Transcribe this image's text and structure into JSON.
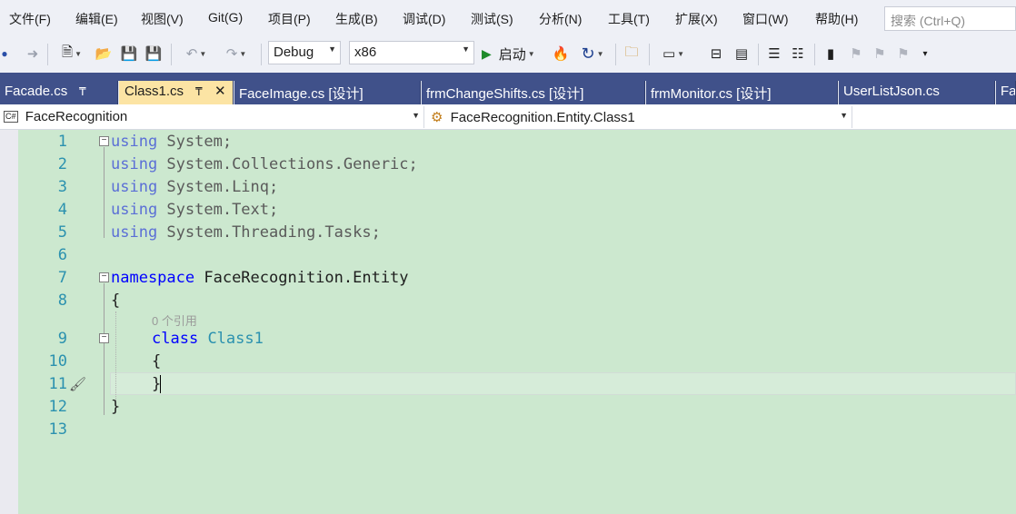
{
  "menu": {
    "items": [
      "文件(F)",
      "编辑(E)",
      "视图(V)",
      "Git(G)",
      "项目(P)",
      "生成(B)",
      "调试(D)",
      "测试(S)",
      "分析(N)",
      "工具(T)",
      "扩展(X)",
      "窗口(W)",
      "帮助(H)"
    ],
    "search_placeholder": "搜索 (Ctrl+Q)"
  },
  "toolbar": {
    "configuration": "Debug",
    "platform": "x86",
    "start_label": "启动"
  },
  "tabs": [
    {
      "label": "Facade.cs",
      "active": false,
      "pinned": true
    },
    {
      "label": "Class1.cs",
      "active": true,
      "pinned": true
    },
    {
      "label": "FaceImage.cs [设计]",
      "active": false
    },
    {
      "label": "frmChangeShifts.cs [设计]",
      "active": false
    },
    {
      "label": "frmMonitor.cs [设计]",
      "active": false
    },
    {
      "label": "UserListJson.cs",
      "active": false
    },
    {
      "label": "Fa",
      "active": false
    }
  ],
  "navbar": {
    "project": "FaceRecognition",
    "project_badge": "C#",
    "type": "FaceRecognition.Entity.Class1",
    "member": ""
  },
  "editor": {
    "line_numbers": [
      "1",
      "2",
      "3",
      "4",
      "5",
      "6",
      "7",
      "8",
      "9",
      "10",
      "11",
      "12",
      "13"
    ],
    "codelens": "0 个引用",
    "lines": {
      "l1": {
        "kw": "using",
        "rest": " System;"
      },
      "l2": {
        "kw": "using",
        "rest": " System.Collections.Generic;"
      },
      "l3": {
        "kw": "using",
        "rest": " System.Linq;"
      },
      "l4": {
        "kw": "using",
        "rest": " System.Text;"
      },
      "l5": {
        "kw": "using",
        "rest": " System.Threading.Tasks;"
      },
      "l7": {
        "kw": "namespace",
        "rest": " FaceRecognition.Entity"
      },
      "l8": {
        "text": "{"
      },
      "l9": {
        "kw": "class",
        "type": "Class1"
      },
      "l10": {
        "text": "{"
      },
      "l11": {
        "text": "}"
      },
      "l12": {
        "text": "}"
      }
    }
  },
  "colors": {
    "keyword": "#0000ff",
    "type": "#2b91af",
    "line_number": "#2b91af",
    "editor_bg": "#cce8cf",
    "tab_bg": "#40518a",
    "active_tab_bg": "#fce4a4"
  }
}
